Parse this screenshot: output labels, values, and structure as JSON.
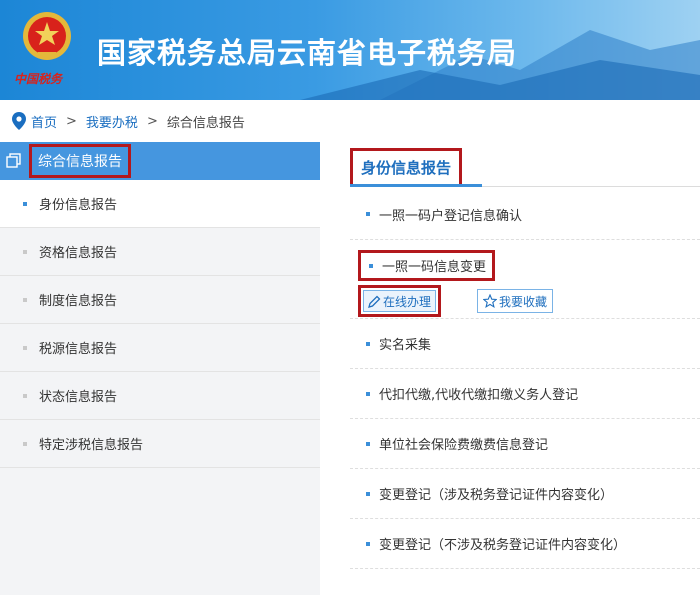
{
  "header": {
    "title": "国家税务总局云南省电子税务局",
    "emblem_caption": "中国税务"
  },
  "breadcrumb": {
    "home": "首页",
    "sep1": ">",
    "level2": "我要办税",
    "sep2": ">",
    "current": "综合信息报告"
  },
  "sidebar": {
    "heading": "综合信息报告",
    "items": [
      {
        "label": "身份信息报告"
      },
      {
        "label": "资格信息报告"
      },
      {
        "label": "制度信息报告"
      },
      {
        "label": "税源信息报告"
      },
      {
        "label": "状态信息报告"
      },
      {
        "label": "特定涉税信息报告"
      }
    ]
  },
  "main": {
    "tab": "身份信息报告",
    "entries": [
      {
        "label": "一照一码户登记信息确认"
      },
      {
        "label": "一照一码信息变更",
        "online_button": "在线办理",
        "fav_button": "我要收藏"
      },
      {
        "label": "实名采集"
      },
      {
        "label": "代扣代缴,代收代缴扣缴义务人登记"
      },
      {
        "label": "单位社会保险费缴费信息登记"
      },
      {
        "label": "变更登记（涉及税务登记证件内容变化）"
      },
      {
        "label": "变更登记（不涉及税务登记证件内容变化）"
      }
    ]
  },
  "colors": {
    "banner": "#1c86d6",
    "sidebar_active": "#4596df",
    "link": "#1a6ec0",
    "highlight_box": "#b3181c"
  }
}
